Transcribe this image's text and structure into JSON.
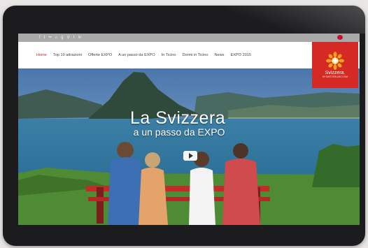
{
  "site": {
    "social_icons": [
      "f",
      "t",
      "••",
      "⌂",
      "g",
      "⚲",
      "t",
      "in"
    ],
    "nav": {
      "items": [
        {
          "label": "Home",
          "active": true
        },
        {
          "label": "Top 10 attrazioni",
          "active": false
        },
        {
          "label": "Offerte EXPO",
          "active": false
        },
        {
          "label": "A un passo da EXPO",
          "active": false
        },
        {
          "label": "In Ticino",
          "active": false
        },
        {
          "label": "Dormi in Ticino",
          "active": false
        },
        {
          "label": "News",
          "active": false
        },
        {
          "label": "EXPO 2015",
          "active": false
        }
      ]
    },
    "logo": {
      "name": "Svizzera.",
      "tagline": "MYSWITZERLAND.COM"
    },
    "hero": {
      "title": "La Svizzera",
      "subtitle": "a un passo da EXPO"
    },
    "colors": {
      "brand_red": "#d52a24",
      "social_bar": "#aaa9a9"
    }
  }
}
